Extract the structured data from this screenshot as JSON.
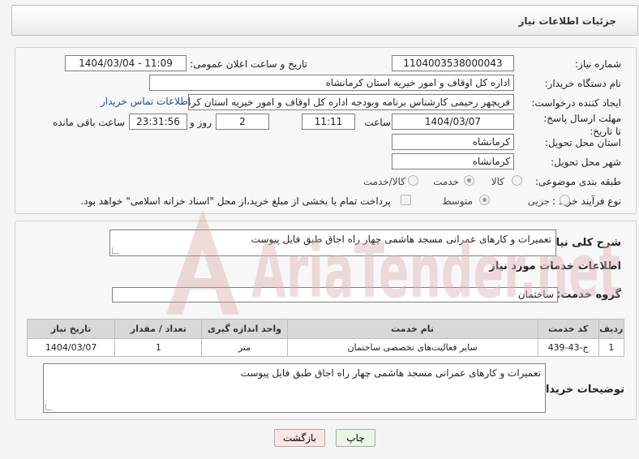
{
  "header": {
    "title": "جزئیات اطلاعات نیاز"
  },
  "form": {
    "need_number_label": "شماره نیاز:",
    "need_number": "1104003538000043",
    "announce_label": "تاریخ و ساعت اعلان عمومی:",
    "announce_value": "1404/03/04 - 11:09",
    "buyer_org_label": "نام دستگاه خریدار:",
    "buyer_org": "اداره کل اوقاف و امور خیریه استان کرمانشاه",
    "creator_label": "ایجاد کننده درخواست:",
    "creator": "فریچهر رحیمی کارشناس برنامه وبودجه اداره کل اوقاف و امور خیریه استان کرمانشاه",
    "contact_link": "اطلاعات تماس خریدار",
    "deadline_label": "مهلت ارسال پاسخ: تا تاریخ:",
    "deadline_date": "1404/03/07",
    "time_label": "ساعت",
    "deadline_time": "11:11",
    "days_value": "2",
    "days_label": "روز و",
    "remaining_time": "23:31:56",
    "remaining_label": "ساعت باقی مانده",
    "province_label": "استان محل تحویل:",
    "province": "کرمانشاه",
    "city_label": "شهر محل تحویل:",
    "city": "کرمانشاه",
    "category_label": "طبقه بندی موضوعی:",
    "category_options": [
      "کالا",
      "خدمت",
      "کالا/خدمت"
    ],
    "category_selected": 1,
    "process_label": "نوع فرآیند خرید :",
    "process_options": [
      "جزیی",
      "متوسط"
    ],
    "process_selected": 1,
    "payment_note": "پرداخت تمام یا بخشی از مبلغ خرید،از محل \"اسناد خزانه اسلامی\" خواهد بود."
  },
  "description": {
    "label": "شرح کلی نیاز:",
    "text": "تعمیرات و کارهای عمرانی مسجد هاشمی چهار راه اجاق طبق فایل پیوست"
  },
  "services": {
    "section_title": "اطلاعات خدمات مورد نیاز",
    "group_label": "گروه خدمت:",
    "group_value": "ساختمان",
    "columns": [
      "ردیف",
      "کد خدمت",
      "نام خدمت",
      "واحد اندازه گیری",
      "تعداد / مقدار",
      "تاریخ نیاز"
    ],
    "rows": [
      [
        "1",
        "ج-43-439",
        "سایر فعالیت‌های تخصصی ساختمان",
        "متر",
        "1",
        "1404/03/07"
      ]
    ]
  },
  "buyer_notes": {
    "label": "توضیحات خریدار:",
    "text": "تعمیرات و کارهای عمرانی مسجد هاشمی چهار راه اجاق طبق فایل پیوست"
  },
  "buttons": {
    "print": "چاپ",
    "back": "بازگشت"
  },
  "colors": {
    "back_button_bg": "#fde5e5",
    "print_button_bg": "#e8f6e3",
    "link": "#1a4fa0",
    "watermark": "#e0b3b3"
  },
  "watermark": {
    "text": "AriaTender.net"
  }
}
